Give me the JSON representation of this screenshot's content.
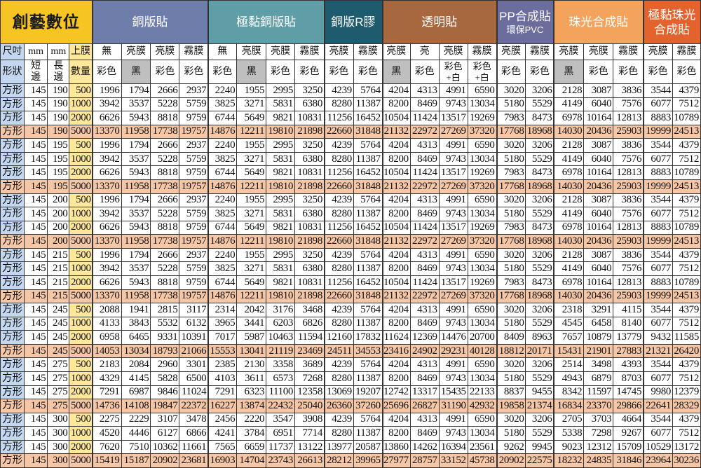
{
  "brand": "創藝數位",
  "colors": {
    "brand_bg": "#F6C423",
    "shape_bg": "#C3D8F0",
    "qty_bg": "#FFE89A",
    "shade_bg": "#BFBFBF",
    "highlight_bg": "#F6C7A6",
    "grid_line": "#333333"
  },
  "header": {
    "size_label": "尺吋",
    "short_unit": "mm",
    "long_unit": "mm",
    "film_label": "上膜",
    "shape_label": "形狀",
    "short_label": "短邊",
    "long_label": "長邊",
    "qty_label": "數量"
  },
  "groups": [
    {
      "name": "銅版貼",
      "color": "#6E7DA9",
      "columns": [
        {
          "film": "無",
          "ink": "彩色"
        },
        {
          "film": "亮膜",
          "ink": "黑",
          "shaded": true
        },
        {
          "film": "亮膜",
          "ink": "彩色"
        },
        {
          "film": "霧膜",
          "ink": "彩色"
        }
      ]
    },
    {
      "name": "極黏銅版貼",
      "color": "#5F9EA6",
      "columns": [
        {
          "film": "無",
          "ink": "彩色"
        },
        {
          "film": "亮膜",
          "ink": "黑",
          "shaded": true
        },
        {
          "film": "亮膜",
          "ink": "彩色"
        },
        {
          "film": "霧膜",
          "ink": "彩色"
        }
      ]
    },
    {
      "name": "銅版R膠",
      "color": "#1E5B6F",
      "columns": [
        {
          "film": "亮膜",
          "ink": "彩色"
        },
        {
          "film": "霧膜",
          "ink": "彩色"
        }
      ]
    },
    {
      "name": "透明貼",
      "color": "#A8683F",
      "columns": [
        {
          "film": "亮膜",
          "ink": "黑",
          "shaded": true
        },
        {
          "film": "亮",
          "ink": "彩色"
        },
        {
          "film": "亮膜",
          "ink": "彩色",
          "ink_line2": "+白"
        },
        {
          "film": "霧膜",
          "ink": "彩色",
          "ink_line2": "+白"
        }
      ]
    },
    {
      "name": "PP合成貼",
      "subname": "環保PVC",
      "color": "#6B6E9D",
      "columns": [
        {
          "film": "亮膜",
          "ink": "彩色"
        },
        {
          "film": "霧膜",
          "ink": "彩色"
        }
      ]
    },
    {
      "name": "珠光合成貼",
      "color": "#F3A35B",
      "columns": [
        {
          "film": "亮膜",
          "ink": "黑",
          "shaded": true
        },
        {
          "film": "亮膜",
          "ink": "彩色"
        },
        {
          "film": "霧膜",
          "ink": "彩色"
        }
      ]
    },
    {
      "name": "極黏珠光",
      "subname": "合成貼",
      "color": "#E4622B",
      "columns": [
        {
          "film": "亮膜",
          "ink": "彩色"
        },
        {
          "film": "霧膜",
          "ink": "彩色"
        }
      ]
    }
  ],
  "rows": [
    {
      "shape": "方形",
      "short": 145,
      "long": 190,
      "qty": 500,
      "prices": [
        1996,
        1794,
        2666,
        2937,
        2240,
        1955,
        2995,
        3250,
        4239,
        5764,
        4204,
        4313,
        4991,
        6590,
        3020,
        3206,
        2128,
        3087,
        3836,
        3544,
        4379
      ]
    },
    {
      "shape": "方形",
      "short": 145,
      "long": 190,
      "qty": 1000,
      "prices": [
        3942,
        3537,
        5228,
        5759,
        3825,
        3271,
        5831,
        6380,
        8280,
        11387,
        8200,
        8469,
        9743,
        13034,
        5180,
        5529,
        4149,
        6040,
        7576,
        6077,
        7512
      ]
    },
    {
      "shape": "方形",
      "short": 145,
      "long": 190,
      "qty": 2000,
      "prices": [
        6626,
        5943,
        8818,
        9759,
        6744,
        5649,
        9821,
        10831,
        11256,
        16452,
        10504,
        11424,
        13517,
        19269,
        7983,
        8473,
        6978,
        10164,
        12813,
        8883,
        10789
      ]
    },
    {
      "shape": "方形",
      "short": 145,
      "long": 190,
      "qty": 5000,
      "highlight": true,
      "prices": [
        13370,
        11958,
        17738,
        19757,
        14876,
        12211,
        19810,
        21898,
        22660,
        31848,
        21132,
        22972,
        27269,
        37320,
        17768,
        18968,
        14030,
        20436,
        25903,
        19999,
        24513
      ]
    },
    {
      "shape": "方形",
      "short": 145,
      "long": 195,
      "qty": 500,
      "prices": [
        1996,
        1794,
        2666,
        2937,
        2240,
        1955,
        2995,
        3250,
        4239,
        5764,
        4204,
        4313,
        4991,
        6590,
        3020,
        3206,
        2128,
        3087,
        3836,
        3544,
        4379
      ]
    },
    {
      "shape": "方形",
      "short": 145,
      "long": 195,
      "qty": 1000,
      "prices": [
        3942,
        3537,
        5228,
        5759,
        3825,
        3271,
        5831,
        6380,
        8280,
        11387,
        8200,
        8469,
        9743,
        13034,
        5180,
        5529,
        4149,
        6040,
        7576,
        6077,
        7512
      ]
    },
    {
      "shape": "方形",
      "short": 145,
      "long": 195,
      "qty": 2000,
      "prices": [
        6626,
        5943,
        8818,
        9759,
        6744,
        5649,
        9821,
        10831,
        11256,
        16452,
        10504,
        11424,
        13517,
        19269,
        7983,
        8473,
        6978,
        10164,
        12813,
        8883,
        10789
      ]
    },
    {
      "shape": "方形",
      "short": 145,
      "long": 195,
      "qty": 5000,
      "highlight": true,
      "prices": [
        13370,
        11958,
        17738,
        19757,
        14876,
        12211,
        19810,
        21898,
        22660,
        31848,
        21132,
        22972,
        27269,
        37320,
        17768,
        18968,
        14030,
        20436,
        25903,
        19999,
        24513
      ]
    },
    {
      "shape": "方形",
      "short": 145,
      "long": 200,
      "qty": 500,
      "prices": [
        1996,
        1794,
        2666,
        2937,
        2240,
        1955,
        2995,
        3250,
        4239,
        5764,
        4204,
        4313,
        4991,
        6590,
        3020,
        3206,
        2128,
        3087,
        3836,
        3544,
        4379
      ]
    },
    {
      "shape": "方形",
      "short": 145,
      "long": 200,
      "qty": 1000,
      "prices": [
        3942,
        3537,
        5228,
        5759,
        3825,
        3271,
        5831,
        6380,
        8280,
        11387,
        8200,
        8469,
        9743,
        13034,
        5180,
        5529,
        4149,
        6040,
        7576,
        6077,
        7512
      ]
    },
    {
      "shape": "方形",
      "short": 145,
      "long": 200,
      "qty": 2000,
      "prices": [
        6626,
        5943,
        8818,
        9759,
        6744,
        5649,
        9821,
        10831,
        11256,
        16452,
        10504,
        11424,
        13517,
        19269,
        7983,
        8473,
        6978,
        10164,
        12813,
        8883,
        10789
      ]
    },
    {
      "shape": "方形",
      "short": 145,
      "long": 200,
      "qty": 5000,
      "highlight": true,
      "prices": [
        13370,
        11958,
        17738,
        19757,
        14876,
        12211,
        19810,
        21898,
        22660,
        31848,
        21132,
        22972,
        27269,
        37320,
        17768,
        18968,
        14030,
        20436,
        25903,
        19999,
        24513
      ]
    },
    {
      "shape": "方形",
      "short": 145,
      "long": 215,
      "qty": 500,
      "prices": [
        1996,
        1794,
        2666,
        2937,
        2240,
        1955,
        2995,
        3250,
        4239,
        5764,
        4204,
        4313,
        4991,
        6590,
        3020,
        3206,
        2128,
        3087,
        3836,
        3544,
        4379
      ]
    },
    {
      "shape": "方形",
      "short": 145,
      "long": 215,
      "qty": 1000,
      "prices": [
        3942,
        3537,
        5228,
        5759,
        3825,
        3271,
        5831,
        6380,
        8280,
        11387,
        8200,
        8469,
        9743,
        13034,
        5180,
        5529,
        4149,
        6040,
        7576,
        6077,
        7512
      ]
    },
    {
      "shape": "方形",
      "short": 145,
      "long": 215,
      "qty": 2000,
      "prices": [
        6626,
        5943,
        8818,
        9759,
        6744,
        5649,
        9821,
        10831,
        11256,
        16452,
        10504,
        11424,
        13517,
        19269,
        7983,
        8473,
        6978,
        10164,
        12813,
        8883,
        10789
      ]
    },
    {
      "shape": "方形",
      "short": 145,
      "long": 215,
      "qty": 5000,
      "highlight": true,
      "prices": [
        13370,
        11958,
        17738,
        19757,
        14876,
        12211,
        19810,
        21898,
        22660,
        31848,
        21132,
        22972,
        27269,
        37320,
        17768,
        18968,
        14030,
        20436,
        25903,
        19999,
        24513
      ]
    },
    {
      "shape": "方形",
      "short": 145,
      "long": 245,
      "qty": 500,
      "prices": [
        2088,
        1941,
        2815,
        3117,
        2314,
        2042,
        3176,
        3468,
        4239,
        5764,
        4204,
        4313,
        4991,
        6590,
        3020,
        3206,
        2318,
        3291,
        4115,
        3544,
        4379
      ]
    },
    {
      "shape": "方形",
      "short": 145,
      "long": 245,
      "qty": 1000,
      "prices": [
        4133,
        3843,
        5532,
        6132,
        3965,
        3441,
        6203,
        6826,
        8280,
        11387,
        8200,
        8469,
        9743,
        13034,
        5180,
        5529,
        4545,
        6458,
        8140,
        6077,
        7512
      ]
    },
    {
      "shape": "方形",
      "short": 145,
      "long": 245,
      "qty": 2000,
      "prices": [
        6958,
        6465,
        9331,
        10391,
        7017,
        5987,
        10463,
        11594,
        12160,
        17832,
        11624,
        12369,
        14476,
        20700,
        8409,
        8963,
        7657,
        10879,
        13779,
        9432,
        11585
      ]
    },
    {
      "shape": "方形",
      "short": 145,
      "long": 245,
      "qty": 5000,
      "highlight": true,
      "prices": [
        14053,
        13034,
        18793,
        21066,
        15553,
        13041,
        21119,
        23469,
        24511,
        34553,
        23416,
        24902,
        29231,
        40128,
        18812,
        20171,
        15431,
        21901,
        27883,
        21321,
        26420
      ]
    },
    {
      "shape": "方形",
      "short": 145,
      "long": 275,
      "qty": 500,
      "prices": [
        2183,
        2084,
        2960,
        3301,
        2385,
        2130,
        3358,
        3689,
        4239,
        5764,
        4204,
        4313,
        4991,
        6590,
        3020,
        3206,
        2514,
        3498,
        4393,
        3544,
        4379
      ]
    },
    {
      "shape": "方形",
      "short": 145,
      "long": 275,
      "qty": 1000,
      "prices": [
        4329,
        4145,
        5828,
        6500,
        4103,
        3611,
        6573,
        7268,
        8280,
        11387,
        8200,
        8469,
        9743,
        13034,
        5180,
        5529,
        4943,
        6879,
        8703,
        6077,
        7512
      ]
    },
    {
      "shape": "方形",
      "short": 145,
      "long": 275,
      "qty": 2000,
      "prices": [
        7291,
        6987,
        9846,
        11024,
        7291,
        6323,
        11100,
        12358,
        13069,
        19207,
        12742,
        13317,
        15435,
        22133,
        8837,
        9455,
        8342,
        11597,
        14745,
        9980,
        12379
      ]
    },
    {
      "shape": "方形",
      "short": 145,
      "long": 275,
      "qty": 5000,
      "highlight": true,
      "prices": [
        14736,
        14108,
        19847,
        22372,
        16227,
        13874,
        22432,
        25040,
        26360,
        37260,
        25696,
        26827,
        31190,
        42932,
        19858,
        21374,
        16834,
        23370,
        29866,
        22641,
        28329
      ]
    },
    {
      "shape": "方形",
      "short": 145,
      "long": 300,
      "qty": 500,
      "prices": [
        2275,
        2229,
        3107,
        3478,
        2456,
        2220,
        3547,
        3908,
        4239,
        5764,
        4204,
        4313,
        4991,
        6590,
        3020,
        3206,
        2705,
        3703,
        4664,
        3544,
        4379
      ]
    },
    {
      "shape": "方形",
      "short": 145,
      "long": 300,
      "qty": 1000,
      "prices": [
        4520,
        4446,
        6127,
        6866,
        4241,
        3784,
        6951,
        7714,
        8280,
        11387,
        8200,
        8469,
        9743,
        13034,
        5180,
        5529,
        5338,
        7298,
        9267,
        6077,
        7512
      ]
    },
    {
      "shape": "方形",
      "short": 145,
      "long": 300,
      "qty": 2000,
      "prices": [
        7620,
        7510,
        10362,
        11661,
        7565,
        6659,
        11737,
        13122,
        13977,
        20587,
        13860,
        14262,
        16394,
        23561,
        9262,
        9945,
        9023,
        12312,
        15709,
        10529,
        13172
      ]
    },
    {
      "shape": "方形",
      "short": 145,
      "long": 300,
      "qty": 5000,
      "highlight": true,
      "prices": [
        15419,
        15187,
        20902,
        23681,
        16903,
        14704,
        23743,
        26613,
        28212,
        39965,
        27977,
        28757,
        33152,
        45738,
        20902,
        22575,
        18232,
        24835,
        31846,
        23964,
        30236
      ]
    }
  ]
}
